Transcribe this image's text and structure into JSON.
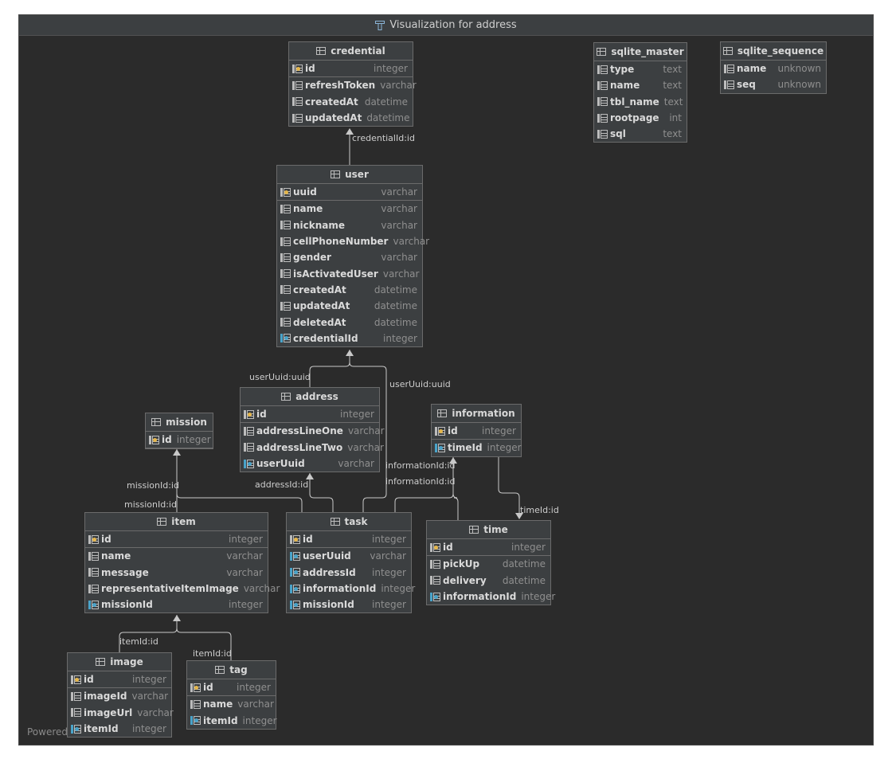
{
  "window": {
    "title": "Visualization for address",
    "footer": "Powered"
  },
  "tables": {
    "credential": {
      "name": "credential",
      "fields": [
        {
          "name": "id",
          "type": "integer",
          "kind": "pk"
        },
        {
          "name": "refreshToken",
          "type": "varchar",
          "kind": "col"
        },
        {
          "name": "createdAt",
          "type": "datetime",
          "kind": "col"
        },
        {
          "name": "updatedAt",
          "type": "datetime",
          "kind": "col"
        }
      ]
    },
    "user": {
      "name": "user",
      "fields": [
        {
          "name": "uuid",
          "type": "varchar",
          "kind": "pk"
        },
        {
          "name": "name",
          "type": "varchar",
          "kind": "col"
        },
        {
          "name": "nickname",
          "type": "varchar",
          "kind": "col"
        },
        {
          "name": "cellPhoneNumber",
          "type": "varchar",
          "kind": "col"
        },
        {
          "name": "gender",
          "type": "varchar",
          "kind": "col"
        },
        {
          "name": "isActivatedUser",
          "type": "varchar",
          "kind": "col"
        },
        {
          "name": "createdAt",
          "type": "datetime",
          "kind": "col"
        },
        {
          "name": "updatedAt",
          "type": "datetime",
          "kind": "col"
        },
        {
          "name": "deletedAt",
          "type": "datetime",
          "kind": "col"
        },
        {
          "name": "credentialId",
          "type": "integer",
          "kind": "fk"
        }
      ]
    },
    "sqlite_master": {
      "name": "sqlite_master",
      "fields": [
        {
          "name": "type",
          "type": "text",
          "kind": "col"
        },
        {
          "name": "name",
          "type": "text",
          "kind": "col"
        },
        {
          "name": "tbl_name",
          "type": "text",
          "kind": "col"
        },
        {
          "name": "rootpage",
          "type": "int",
          "kind": "col"
        },
        {
          "name": "sql",
          "type": "text",
          "kind": "col"
        }
      ]
    },
    "sqlite_sequence": {
      "name": "sqlite_sequence",
      "fields": [
        {
          "name": "name",
          "type": "unknown",
          "kind": "col"
        },
        {
          "name": "seq",
          "type": "unknown",
          "kind": "col"
        }
      ]
    },
    "address": {
      "name": "address",
      "fields": [
        {
          "name": "id",
          "type": "integer",
          "kind": "pk"
        },
        {
          "name": "addressLineOne",
          "type": "varchar",
          "kind": "col"
        },
        {
          "name": "addressLineTwo",
          "type": "varchar",
          "kind": "col"
        },
        {
          "name": "userUuid",
          "type": "varchar",
          "kind": "fk"
        }
      ]
    },
    "mission": {
      "name": "mission",
      "fields": [
        {
          "name": "id",
          "type": "integer",
          "kind": "pk"
        }
      ]
    },
    "information": {
      "name": "information",
      "fields": [
        {
          "name": "id",
          "type": "integer",
          "kind": "pk"
        },
        {
          "name": "timeId",
          "type": "integer",
          "kind": "fk"
        }
      ]
    },
    "item": {
      "name": "item",
      "fields": [
        {
          "name": "id",
          "type": "integer",
          "kind": "pk"
        },
        {
          "name": "name",
          "type": "varchar",
          "kind": "col"
        },
        {
          "name": "message",
          "type": "varchar",
          "kind": "col"
        },
        {
          "name": "representativeItemImage",
          "type": "varchar",
          "kind": "col"
        },
        {
          "name": "missionId",
          "type": "integer",
          "kind": "fk"
        }
      ]
    },
    "task": {
      "name": "task",
      "fields": [
        {
          "name": "id",
          "type": "integer",
          "kind": "pk"
        },
        {
          "name": "userUuid",
          "type": "varchar",
          "kind": "fk"
        },
        {
          "name": "addressId",
          "type": "integer",
          "kind": "fk"
        },
        {
          "name": "informationId",
          "type": "integer",
          "kind": "fk"
        },
        {
          "name": "missionId",
          "type": "integer",
          "kind": "fk"
        }
      ]
    },
    "time": {
      "name": "time",
      "fields": [
        {
          "name": "id",
          "type": "integer",
          "kind": "pk"
        },
        {
          "name": "pickUp",
          "type": "datetime",
          "kind": "col"
        },
        {
          "name": "delivery",
          "type": "datetime",
          "kind": "col"
        },
        {
          "name": "informationId",
          "type": "integer",
          "kind": "fk"
        }
      ]
    },
    "image": {
      "name": "image",
      "fields": [
        {
          "name": "id",
          "type": "integer",
          "kind": "pk"
        },
        {
          "name": "imageId",
          "type": "varchar",
          "kind": "col"
        },
        {
          "name": "imageUrl",
          "type": "varchar",
          "kind": "col"
        },
        {
          "name": "itemId",
          "type": "integer",
          "kind": "fk"
        }
      ]
    },
    "tag": {
      "name": "tag",
      "fields": [
        {
          "name": "id",
          "type": "integer",
          "kind": "pk"
        },
        {
          "name": "name",
          "type": "varchar",
          "kind": "col"
        },
        {
          "name": "itemId",
          "type": "integer",
          "kind": "fk"
        }
      ]
    }
  },
  "edge_labels": {
    "credential": "credentialId:id",
    "address_user": "userUuid:uuid",
    "task_user": "userUuid:uuid",
    "task_mission": "missionId:id",
    "item_mission": "missionId:id",
    "task_address": "addressId:id",
    "task_information": "informationId:id",
    "time_information": "informationId:id",
    "information_time": "timeId:id",
    "image_item": "itemId:id",
    "tag_item": "itemId:id"
  },
  "colors": {
    "background": "#2b2b2b",
    "table": "#3c3f41",
    "edge": "#c8c8c8",
    "primary_key": "#e5b64a",
    "foreign_key": "#4aa3c9"
  }
}
